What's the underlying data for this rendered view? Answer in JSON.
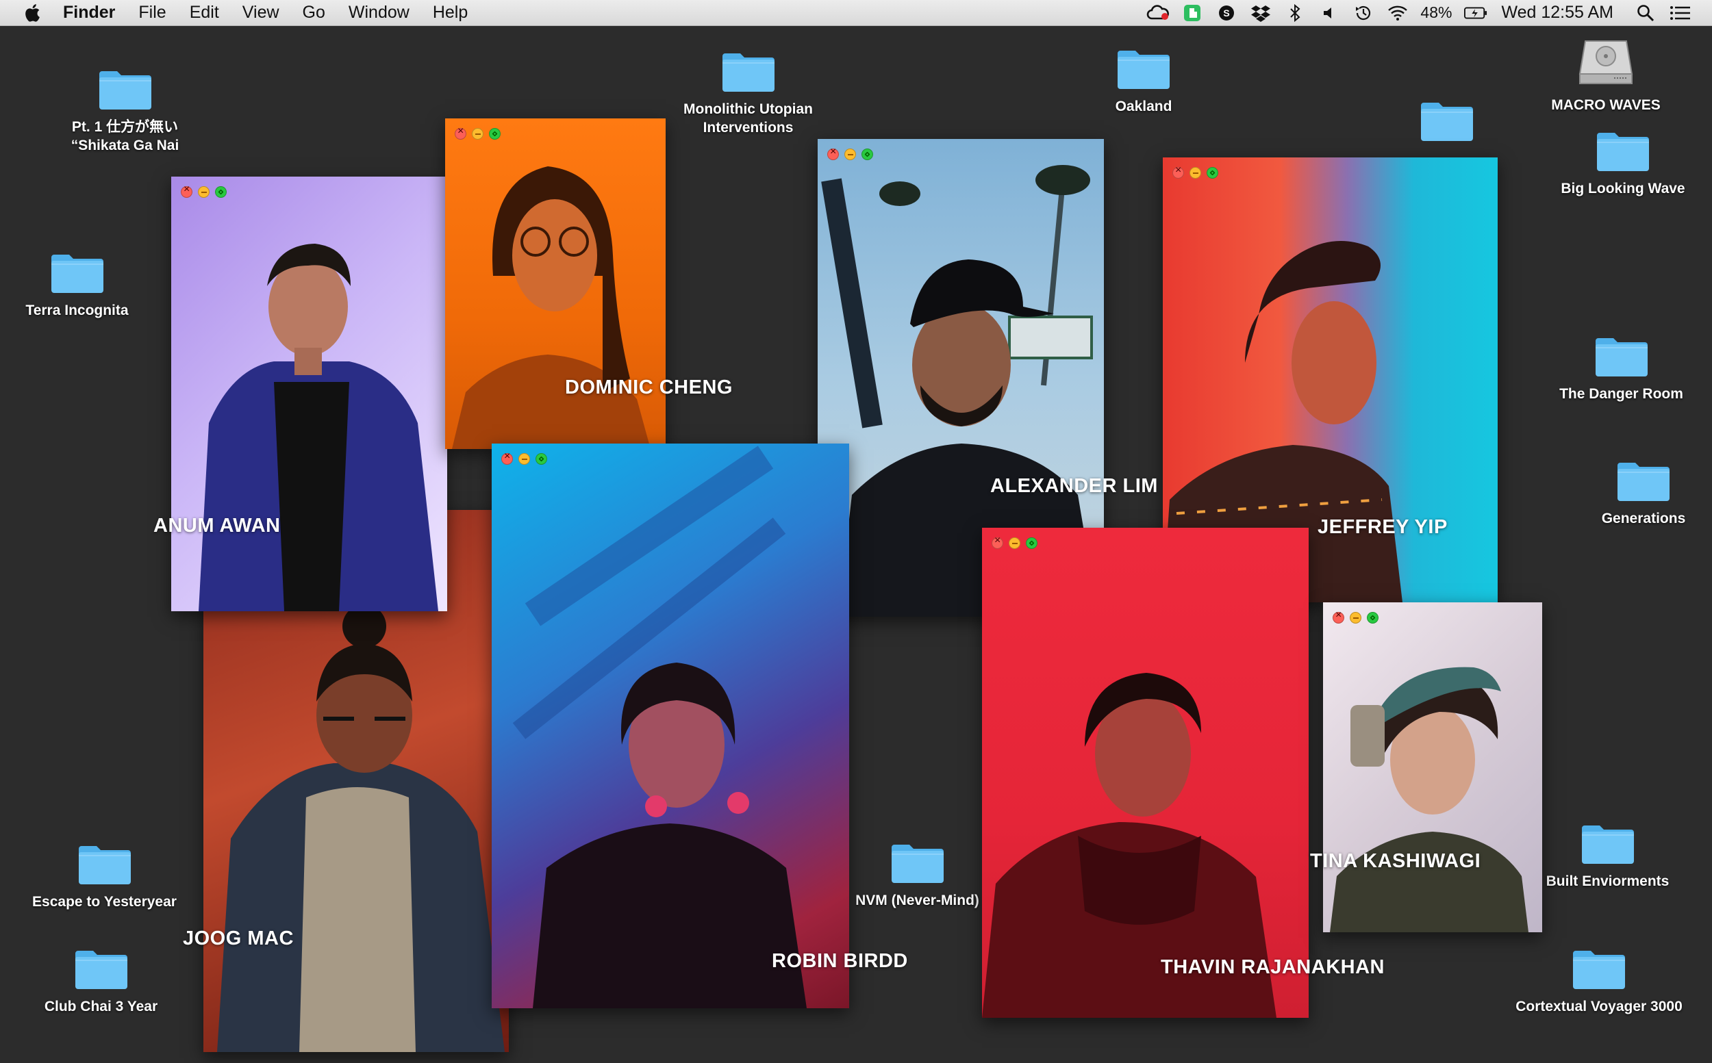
{
  "menubar": {
    "app": "Finder",
    "menus": [
      "File",
      "Edit",
      "View",
      "Go",
      "Window",
      "Help"
    ],
    "battery": "48%",
    "clock": "Wed 12:55 AM",
    "status_icons": [
      "creative-cloud-icon",
      "evernote-icon",
      "skype-icon",
      "dropbox-icon",
      "bluetooth-icon",
      "volume-icon",
      "time-machine-icon",
      "wifi-icon",
      "battery-icon",
      "spotlight-icon",
      "notification-center-icon"
    ]
  },
  "desktop": {
    "items": [
      {
        "label": "Pt. 1 仕方が無い “Shikata Ga Nai",
        "kind": "folder"
      },
      {
        "label": "Terra Incognita",
        "kind": "folder"
      },
      {
        "label": "Monolithic Utopian Interventions",
        "kind": "folder"
      },
      {
        "label": "Oakland",
        "kind": "folder"
      },
      {
        "label": "",
        "kind": "folder"
      },
      {
        "label": "MACRO WAVES",
        "kind": "disk"
      },
      {
        "label": "Big Looking Wave",
        "kind": "folder"
      },
      {
        "label": "The Danger Room",
        "kind": "folder"
      },
      {
        "label": "Generations",
        "kind": "folder"
      },
      {
        "label": "Escape to Yesteryear",
        "kind": "folder"
      },
      {
        "label": "Club Chai 3 Year",
        "kind": "folder"
      },
      {
        "label": "NVM (Never-Mind)",
        "kind": "folder"
      },
      {
        "label": "Built Enviorments",
        "kind": "folder"
      },
      {
        "label": "Cortextual Voyager 3000",
        "kind": "folder"
      }
    ]
  },
  "windows": [
    {
      "name": "ANUM AWAN",
      "bg": "#b59cf0"
    },
    {
      "name": "DOMINIC CHENG",
      "bg": "#f26a10"
    },
    {
      "name": "ALEXANDER LIM",
      "bg": "#8ab5d6"
    },
    {
      "name": "JEFFREY YIP",
      "bg": "#e4433f"
    },
    {
      "name": "ROBIN BIRDD",
      "bg": "#1f8fd0"
    },
    {
      "name": "JOOG MAC",
      "bg": "#b93a25"
    },
    {
      "name": "THAVIN RAJANAKHAN",
      "bg": "#e3283a"
    },
    {
      "name": "TINA KASHIWAGI",
      "bg": "#dcd6dc"
    }
  ],
  "colors": {
    "desktop": "#2c2c2c",
    "folder": "#67c1f5"
  }
}
